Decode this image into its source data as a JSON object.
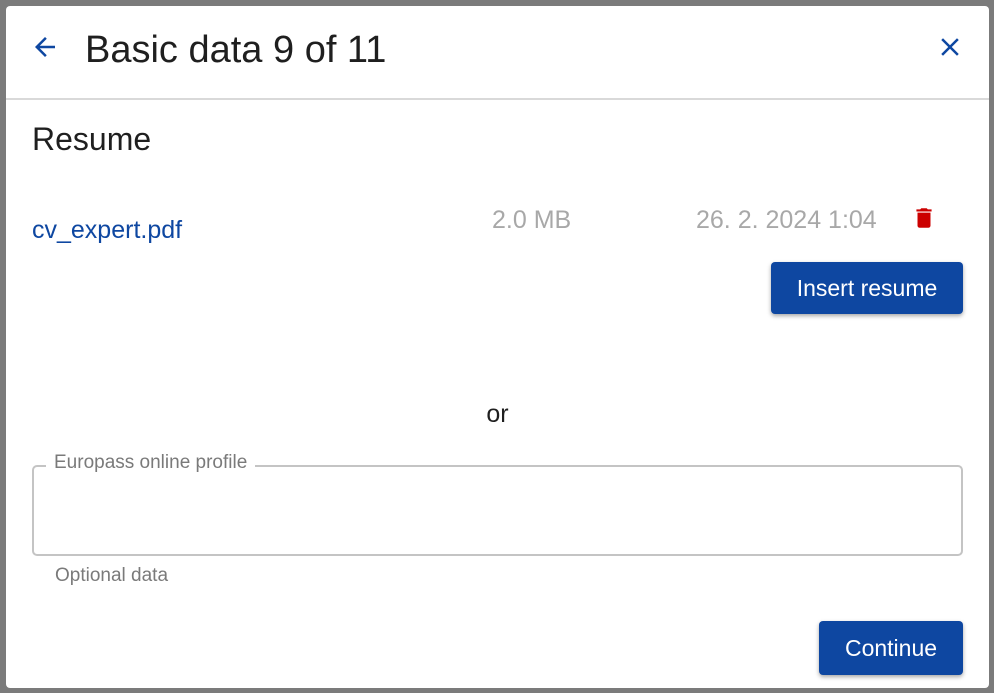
{
  "header": {
    "title": "Basic data 9 of 11",
    "back_icon": "arrow-left-icon",
    "close_icon": "close-icon"
  },
  "section": {
    "title": "Resume"
  },
  "file": {
    "name": "cv_expert.pdf",
    "size": "2.0 MB",
    "date": "26. 2. 2024 1:04",
    "delete_icon": "trash-icon"
  },
  "buttons": {
    "insert_resume": "Insert resume",
    "continue": "Continue"
  },
  "separator": "or",
  "europass_field": {
    "label": "Europass online profile",
    "value": "",
    "helper": "Optional data"
  },
  "colors": {
    "primary": "#0e47a1",
    "delete": "#cc0000",
    "muted": "#a8a8a8"
  }
}
